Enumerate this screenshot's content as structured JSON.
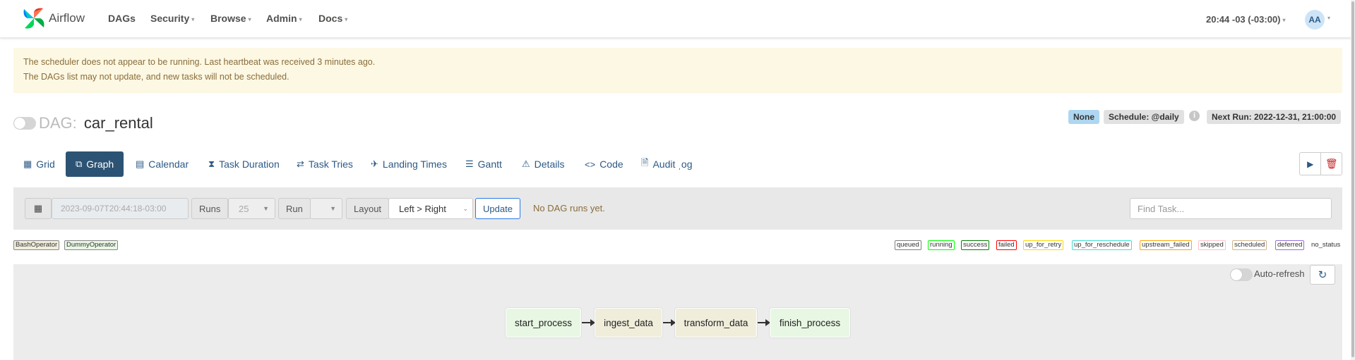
{
  "navbar": {
    "brand": "Airflow",
    "menu": [
      {
        "label": "DAGs"
      },
      {
        "label": "Security"
      },
      {
        "label": "Browse"
      },
      {
        "label": "Admin"
      },
      {
        "label": "Docs"
      }
    ],
    "clock": "20:44 -03 (-03:00)",
    "avatar": "AA"
  },
  "alert": {
    "line1": "The scheduler does not appear to be running. Last heartbeat was received 3 minutes ago.",
    "line2": "The DAGs list may not update, and new tasks will not be scheduled."
  },
  "dag": {
    "prefix": "DAG:",
    "name": "car_rental",
    "paused": true,
    "badge_none": "None",
    "schedule": "Schedule: @daily",
    "next_run": "Next Run: 2022-12-31, 21:00:00"
  },
  "tabs": [
    {
      "label": "Grid",
      "icon": "grid-icon"
    },
    {
      "label": "Graph",
      "icon": "graph-icon",
      "active": true
    },
    {
      "label": "Calendar",
      "icon": "calendar-icon"
    },
    {
      "label": "Task Duration",
      "icon": "hourglass-icon"
    },
    {
      "label": "Task Tries",
      "icon": "retry-icon"
    },
    {
      "label": "Landing Times",
      "icon": "landing-icon"
    },
    {
      "label": "Gantt",
      "icon": "gantt-icon"
    },
    {
      "label": "Details",
      "icon": "warning-icon"
    },
    {
      "label": "Code",
      "icon": "code-icon"
    },
    {
      "label": "Audit ˌog",
      "icon": "audit-icon"
    }
  ],
  "filters": {
    "date_placeholder": "2023-09-07T20:44:18-03:00",
    "runs_label": "Runs",
    "runs_value": "25",
    "run_label": "Run",
    "run_value": "",
    "layout_label": "Layout",
    "layout_value": "Left > Right",
    "update_label": "Update",
    "no_runs": "No DAG runs yet.",
    "find_placeholder": "Find Task..."
  },
  "operators": [
    {
      "label": "BashOperator",
      "color": "#f0eddb"
    },
    {
      "label": "DummyOperator",
      "color": "#e8f7e4"
    }
  ],
  "states": [
    {
      "label": "queued",
      "color": "#808080"
    },
    {
      "label": "running",
      "color": "#00ff00"
    },
    {
      "label": "success",
      "color": "#008000"
    },
    {
      "label": "failed",
      "color": "#ff0000"
    },
    {
      "label": "up_for_retry",
      "color": "#ffd700"
    },
    {
      "label": "up_for_reschedule",
      "color": "#40e0d0"
    },
    {
      "label": "upstream_failed",
      "color": "#ffa500"
    },
    {
      "label": "skipped",
      "color": "#ffc0cb"
    },
    {
      "label": "scheduled",
      "color": "#d2b48c"
    },
    {
      "label": "deferred",
      "color": "#9370db"
    },
    {
      "label": "no_status",
      "color": ""
    }
  ],
  "graph": {
    "auto_refresh": "Auto-refresh",
    "nodes": [
      {
        "label": "start_process",
        "operator": "DummyOperator"
      },
      {
        "label": "ingest_data",
        "operator": "BashOperator"
      },
      {
        "label": "transform_data",
        "operator": "BashOperator"
      },
      {
        "label": "finish_process",
        "operator": "DummyOperator"
      }
    ]
  }
}
